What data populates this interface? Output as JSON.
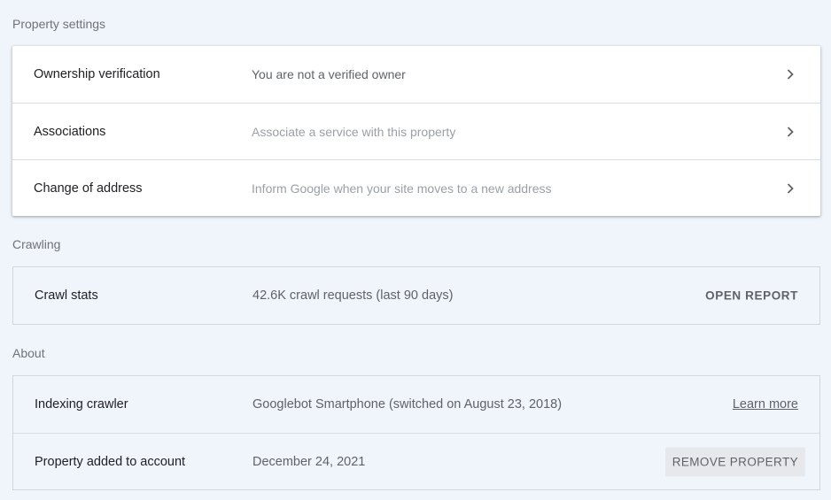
{
  "property_settings": {
    "title": "Property settings",
    "rows": [
      {
        "label": "Ownership verification",
        "value": "You are not a verified owner",
        "icon": "chevron-right-icon"
      },
      {
        "label": "Associations",
        "value": "Associate a service with this property",
        "icon": "chevron-right-icon"
      },
      {
        "label": "Change of address",
        "value": "Inform Google when your site moves to a new address",
        "icon": "chevron-right-icon"
      }
    ]
  },
  "crawling": {
    "title": "Crawling",
    "rows": [
      {
        "label": "Crawl stats",
        "value": "42.6K crawl requests (last 90 days)",
        "action": "OPEN REPORT"
      }
    ]
  },
  "about": {
    "title": "About",
    "rows": [
      {
        "label": "Indexing crawler",
        "value": "Googlebot Smartphone (switched on August 23, 2018)",
        "action": "Learn more"
      },
      {
        "label": "Property added to account",
        "value": "December 24, 2021",
        "action": "REMOVE PROPERTY"
      }
    ]
  },
  "colors": {
    "background": "#f0f4fb",
    "card": "#ffffff",
    "text_primary": "#202124",
    "text_secondary": "#5f6368",
    "text_muted": "#9aa0a6"
  }
}
